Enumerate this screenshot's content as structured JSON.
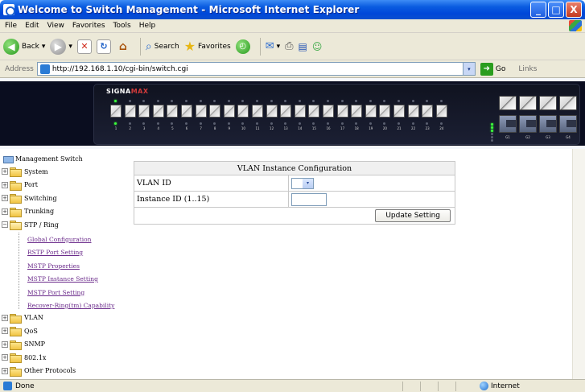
{
  "window": {
    "title": "Welcome to Switch Management - Microsoft Internet Explorer",
    "minimize_glyph": "_",
    "maximize_glyph": "□",
    "close_glyph": "X"
  },
  "menubar": {
    "items": [
      "File",
      "Edit",
      "View",
      "Favorites",
      "Tools",
      "Help"
    ]
  },
  "toolbar": {
    "back_label": "Back",
    "search_label": "Search",
    "favorites_label": "Favorites",
    "dropdown_glyph": "▾"
  },
  "address": {
    "label": "Address",
    "url": "http://192.168.1.10/cgi-bin/switch.cgi",
    "go_label": "Go",
    "links_label": "Links"
  },
  "switch_panel": {
    "brand_prefix": "SIGNA",
    "brand_suffix": "MAX",
    "port_numbers": [
      "1",
      "2",
      "3",
      "4",
      "5",
      "6",
      "7",
      "8",
      "9",
      "10",
      "11",
      "12",
      "13",
      "14",
      "15",
      "16",
      "17",
      "18",
      "19",
      "20",
      "21",
      "22",
      "23",
      "24"
    ],
    "gbic_labels": [
      "G1",
      "G2",
      "G3",
      "G4"
    ]
  },
  "tree": {
    "root_label": "Management Switch",
    "nodes": [
      {
        "label": "System",
        "expander": "+"
      },
      {
        "label": "Port",
        "expander": "+"
      },
      {
        "label": "Switching",
        "expander": "+"
      },
      {
        "label": "Trunking",
        "expander": "+"
      },
      {
        "label": "STP / Ring",
        "expander": "−"
      },
      {
        "label": "VLAN",
        "expander": "+"
      },
      {
        "label": "QoS",
        "expander": "+"
      },
      {
        "label": "SNMP",
        "expander": "+"
      },
      {
        "label": "802.1x",
        "expander": "+"
      },
      {
        "label": "Other Protocols",
        "expander": "+"
      }
    ],
    "stp_children": [
      "Global Configuration",
      "RSTP Port Setting",
      "MSTP Properties",
      "MSTP Instance Setting",
      "MSTP Port Setting",
      "Recover-Ring(tm) Capability"
    ]
  },
  "vlan_form": {
    "title": "VLAN Instance Configuration",
    "vlan_id_label": "VLAN ID",
    "instance_id_label": "Instance ID (1..15)",
    "instance_id_value": "",
    "select_arrow": "▾",
    "update_button": "Update Setting"
  },
  "statusbar": {
    "status_text": "Done",
    "zone_text": "Internet"
  }
}
